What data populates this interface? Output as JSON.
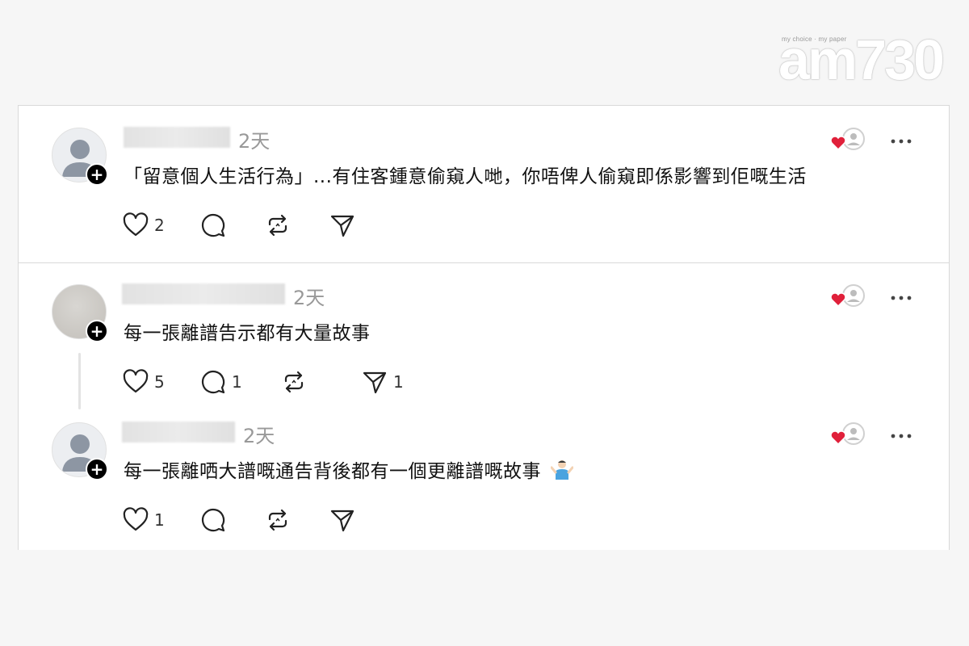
{
  "brand": {
    "tagline": "my choice · my paper",
    "logo_text": "am730"
  },
  "posts": [
    {
      "time": "2天",
      "text": "「留意個人生活行為」...有住客鍾意偷窺人哋，你唔俾人偷窺即係影響到佢嘅生活",
      "likes": "2",
      "replies": "",
      "reposts": "",
      "shares": ""
    },
    {
      "time": "2天",
      "text": "每一張離譜告示都有大量故事",
      "likes": "5",
      "replies": "1",
      "reposts": "",
      "shares": "1"
    },
    {
      "time": "2天",
      "text": "每一張離哂大譜嘅通告背後都有一個更離譜嘅故事",
      "likes": "1",
      "replies": "",
      "reposts": "",
      "shares": ""
    }
  ],
  "colors": {
    "accent_heart": "#e0203a",
    "text": "#111111",
    "muted": "#999999"
  },
  "icons": [
    "heart-icon",
    "comment-icon",
    "repost-icon",
    "share-icon",
    "more-icon",
    "plus-icon",
    "avatar-placeholder-icon",
    "person-shrugging-emoji"
  ]
}
